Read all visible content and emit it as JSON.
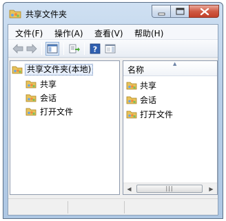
{
  "window": {
    "title": "共享文件夹",
    "icon": "shared-folder-icon"
  },
  "caption_buttons": {
    "minimize_icon": "minimize-icon",
    "maximize_icon": "maximize-icon",
    "close_icon": "close-icon"
  },
  "menu": {
    "items": [
      {
        "label": "文件(F)"
      },
      {
        "label": "操作(A)"
      },
      {
        "label": "查看(V)"
      },
      {
        "label": "帮助(H)"
      }
    ]
  },
  "toolbar": {
    "buttons": [
      "back-arrow-icon",
      "forward-arrow-icon",
      "show-hide-console-tree-icon",
      "export-list-icon",
      "help-icon",
      "show-hide-action-pane-icon"
    ]
  },
  "tree": {
    "root_label": "共享文件夹(本地)",
    "children": [
      {
        "label": "共享"
      },
      {
        "label": "会话"
      },
      {
        "label": "打开文件"
      }
    ]
  },
  "list": {
    "column_header": "名称",
    "sort_indicator": "▲",
    "items": [
      {
        "label": "共享"
      },
      {
        "label": "会话"
      },
      {
        "label": "打开文件"
      }
    ],
    "scroll_left": "◀",
    "scroll_right": "▶",
    "thumb_grip": "|||"
  },
  "colors": {
    "title_bar": "#b8cfe8",
    "close_button": "#c2402a",
    "selection": "#e6eefb"
  }
}
